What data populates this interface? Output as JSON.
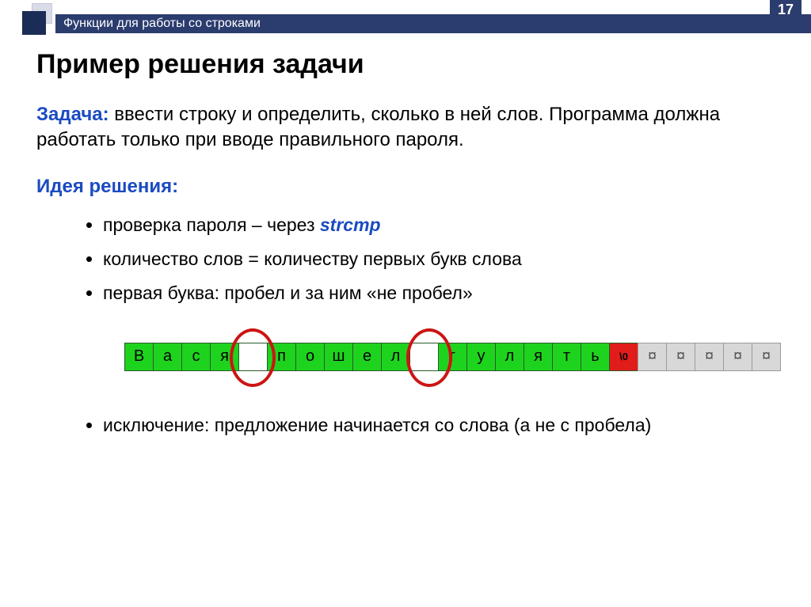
{
  "header": {
    "subtitle": "Функции для работы со строками",
    "page_number": "17"
  },
  "title": "Пример решения задачи",
  "task": {
    "label": "Задача:",
    "text_a": " ввести строку и определить, сколько в ней слов. Программа должна работать только при вводе правильного пароля."
  },
  "idea": {
    "label": "Идея решения:",
    "bullets": [
      {
        "pre": "проверка пароля – через ",
        "code": "strcmp",
        "post": ""
      },
      {
        "pre": "количество слов = количеству первых букв слова",
        "code": "",
        "post": ""
      },
      {
        "pre": "первая буква: пробел и за ним «не пробел»",
        "code": "",
        "post": ""
      }
    ],
    "last_bullet": "исключение: предложение начинается со слова (а не с пробела)"
  },
  "diagram": {
    "cells": [
      {
        "ch": "В",
        "c": "green"
      },
      {
        "ch": "а",
        "c": "green"
      },
      {
        "ch": "с",
        "c": "green"
      },
      {
        "ch": "я",
        "c": "green"
      },
      {
        "ch": "",
        "c": "white"
      },
      {
        "ch": "п",
        "c": "green"
      },
      {
        "ch": "о",
        "c": "green"
      },
      {
        "ch": "ш",
        "c": "green"
      },
      {
        "ch": "е",
        "c": "green"
      },
      {
        "ch": "л",
        "c": "green"
      },
      {
        "ch": "",
        "c": "white"
      },
      {
        "ch": "г",
        "c": "green"
      },
      {
        "ch": "у",
        "c": "green"
      },
      {
        "ch": "л",
        "c": "green"
      },
      {
        "ch": "я",
        "c": "green"
      },
      {
        "ch": "т",
        "c": "green"
      },
      {
        "ch": "ь",
        "c": "green"
      },
      {
        "ch": "\\0",
        "c": "red"
      },
      {
        "ch": "¤",
        "c": "gray"
      },
      {
        "ch": "¤",
        "c": "gray"
      },
      {
        "ch": "¤",
        "c": "gray"
      },
      {
        "ch": "¤",
        "c": "gray"
      },
      {
        "ch": "¤",
        "c": "gray"
      }
    ]
  }
}
